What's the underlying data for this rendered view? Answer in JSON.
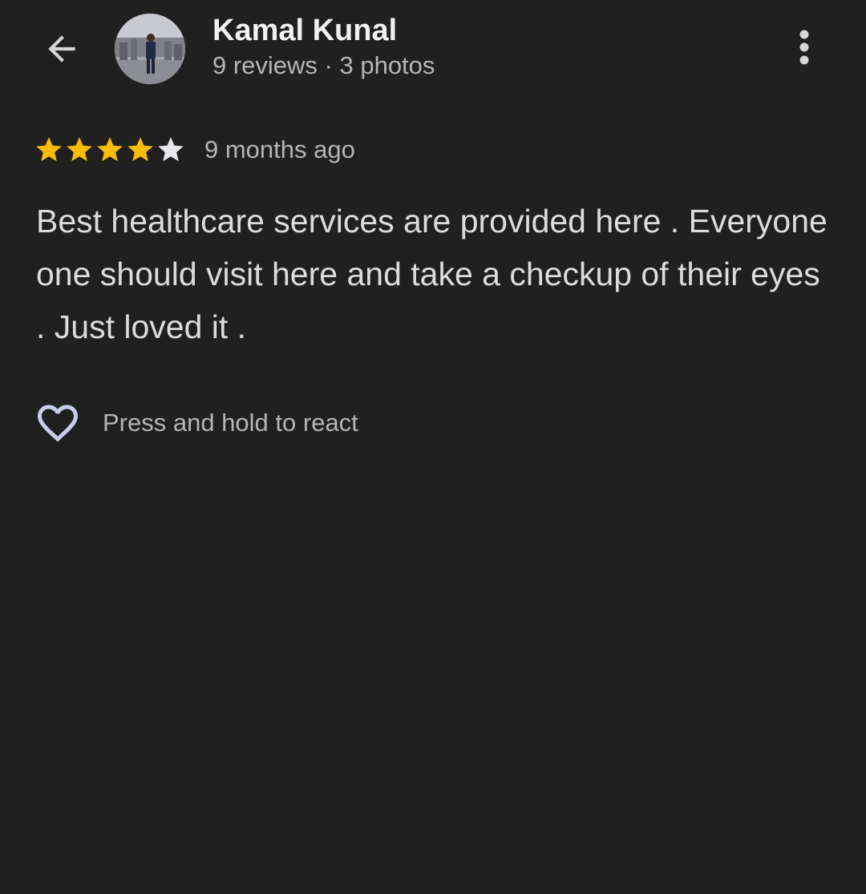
{
  "header": {
    "back_icon": "arrow-back-icon",
    "author_name": "Kamal Kunal",
    "author_meta": "9 reviews · 3 photos",
    "more_icon": "more-vertical-icon"
  },
  "review": {
    "rating": 4,
    "rating_max": 5,
    "star_filled_color": "#fbbc04",
    "star_empty_color": "#e8e8ec",
    "age": "9 months ago",
    "text": "Best healthcare services are provided here . Everyone one should visit here and take a checkup of their eyes . Just loved it ."
  },
  "react": {
    "icon": "heart-outline-icon",
    "label": "Press and hold to react"
  },
  "colors": {
    "background": "#202020",
    "primary_text": "#f1f1f1",
    "secondary_text": "#b5b5b5"
  }
}
